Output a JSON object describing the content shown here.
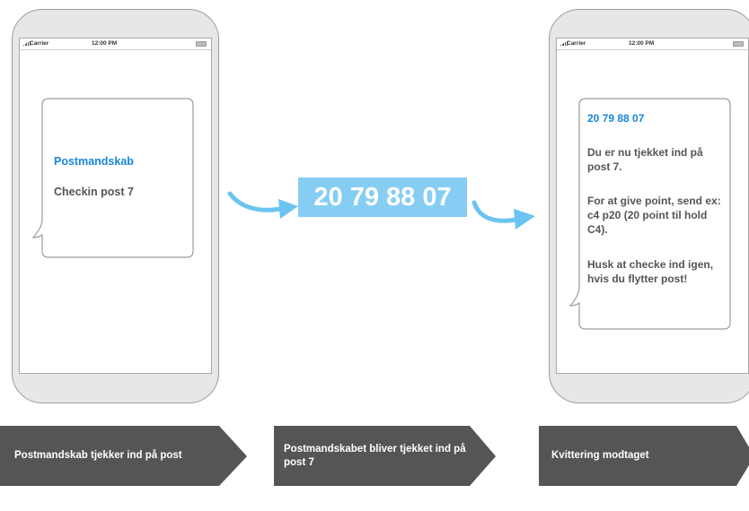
{
  "status_bar": {
    "carrier": "Carrier",
    "time": "12:00 PM"
  },
  "phone_left": {
    "title": "Postmandskab",
    "message": "Checkin post 7"
  },
  "center": {
    "number": "20 79 88 07"
  },
  "phone_right": {
    "title": "20 79 88 07",
    "paragraphs": [
      "Du er nu tjekket ind på post 7.",
      "For at give point, send ex: c4 p20 (20 point til hold C4).",
      "Husk at checke ind igen, hvis du flytter post!"
    ]
  },
  "steps": [
    "Postmandskab tjekker ind på post",
    "Postmandskabet bliver tjekket ind på post 7",
    "Kvittering modtaget"
  ],
  "colors": {
    "accent_blue": "#1a86d9",
    "number_bg": "#86cdf4",
    "arrow": "#6cc4f1",
    "step_bg": "#555555"
  }
}
